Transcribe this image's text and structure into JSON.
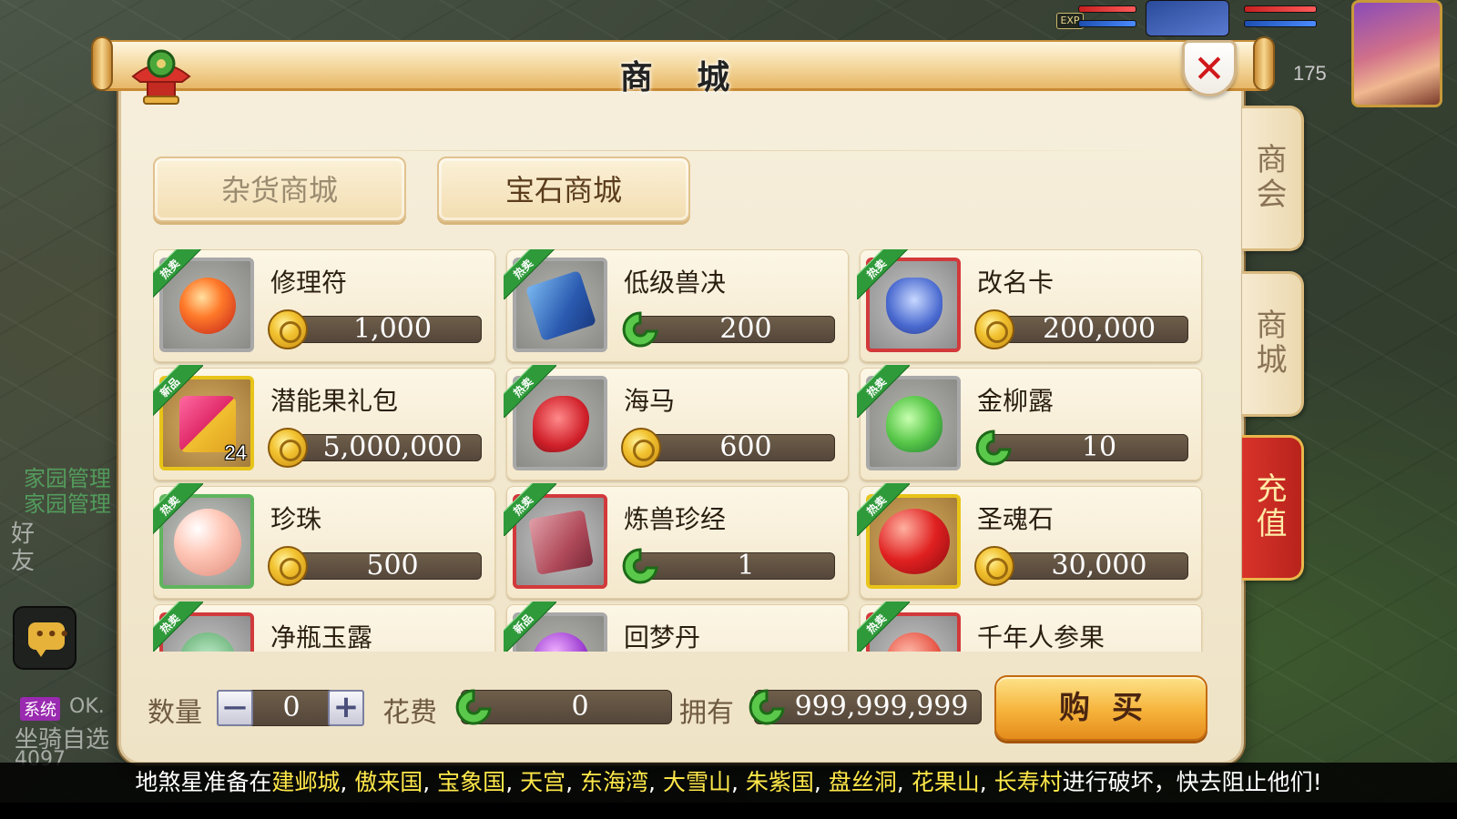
{
  "hud": {
    "exp_label": "EXP",
    "level_fragment": "175"
  },
  "sidebar_left": {
    "labels": [
      "家园管理",
      "家园管理",
      "好",
      "友"
    ],
    "chat_lines": [
      "系统",
      "OK.",
      "坐骑自选",
      "4097"
    ]
  },
  "window": {
    "title": "商 城",
    "close_label": "✕"
  },
  "categories": [
    {
      "label": "杂货商城",
      "state": "inactive"
    },
    {
      "label": "宝石商城",
      "state": "active"
    }
  ],
  "items": [
    {
      "name": "修理符",
      "price": "1,000",
      "currency": "gold-coin",
      "badge": "热卖",
      "frame": "grey",
      "art": "orb-red"
    },
    {
      "name": "低级兽决",
      "price": "200",
      "currency": "jade",
      "badge": "热卖",
      "frame": "grey",
      "art": "book-blue"
    },
    {
      "name": "改名卡",
      "price": "200,000",
      "currency": "gold-coin",
      "badge": "热卖",
      "frame": "red",
      "art": "shield-blue"
    },
    {
      "name": "潜能果礼包",
      "price": "5,000,000",
      "currency": "gold-coin",
      "badge": "新品",
      "frame": "gold",
      "art": "gift-box",
      "count": "24"
    },
    {
      "name": "海马",
      "price": "600",
      "currency": "gold-coin",
      "badge": "热卖",
      "frame": "grey",
      "art": "seahorse-red"
    },
    {
      "name": "金柳露",
      "price": "10",
      "currency": "jade",
      "badge": "热卖",
      "frame": "grey",
      "art": "fruit-green"
    },
    {
      "name": "珍珠",
      "price": "500",
      "currency": "gold-coin",
      "badge": "热卖",
      "frame": "green",
      "art": "pearl-pink"
    },
    {
      "name": "炼兽珍经",
      "price": "1",
      "currency": "jade",
      "badge": "热卖",
      "frame": "red",
      "art": "book-red"
    },
    {
      "name": "圣魂石",
      "price": "30,000",
      "currency": "gold-coin",
      "badge": "热卖",
      "frame": "gold",
      "art": "gem-red"
    },
    {
      "name": "净瓶玉露",
      "price": "",
      "currency": "",
      "badge": "热卖",
      "frame": "red",
      "art": "bottle"
    },
    {
      "name": "回梦丹",
      "price": "",
      "currency": "",
      "badge": "新品",
      "frame": "grey",
      "art": "pill-purple"
    },
    {
      "name": "千年人参果",
      "price": "",
      "currency": "",
      "badge": "热卖",
      "frame": "red",
      "art": "fruit-red"
    }
  ],
  "side_tabs": [
    {
      "label": "商会",
      "state": "inactive"
    },
    {
      "label": "商城",
      "state": "current"
    },
    {
      "label": "充值",
      "state": "highlight"
    }
  ],
  "purchase": {
    "qty_label": "数量",
    "qty_minus": "—",
    "qty_value": "0",
    "qty_plus": "+",
    "cost_label": "花费",
    "cost_value": "0",
    "own_label": "拥有",
    "own_value": "999,999,999",
    "buy_label": "购买"
  },
  "announcement": {
    "prefix": "地煞星准备在",
    "places": [
      "建邺城",
      "傲来国",
      "宝象国",
      "天宫",
      "东海湾",
      "大雪山",
      "朱紫国",
      "盘丝洞",
      "花果山",
      "长寿村"
    ],
    "suffix": "进行破坏，快去阻止他们!"
  },
  "colors": {
    "accent_red": "#d0181a",
    "price_bar": "#54463a",
    "badge_green": "#2f9a3a",
    "highlight_yellow": "#ffe84a"
  }
}
